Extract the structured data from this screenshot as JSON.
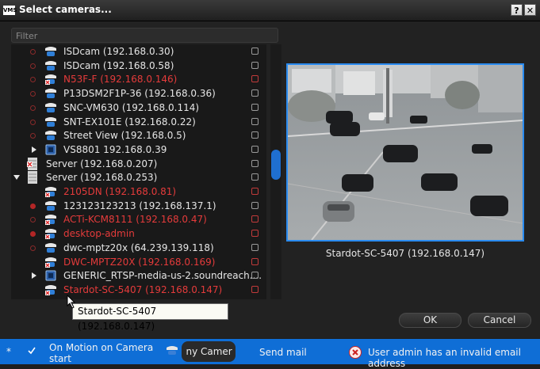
{
  "window": {
    "logo_text": "VMS",
    "title": "Select cameras...",
    "help_button": "?",
    "close_button": "✕"
  },
  "filter": {
    "placeholder": "Filter"
  },
  "tree": {
    "items": [
      {
        "label": "ISDcam (192.168.0.30)",
        "color": "white",
        "type": "camera",
        "status": "ring",
        "checkbox": "normal"
      },
      {
        "label": "ISDcam (192.168.0.58)",
        "color": "white",
        "type": "camera",
        "status": "ring",
        "checkbox": "normal"
      },
      {
        "label": "N53F-F (192.168.0.146)",
        "color": "red",
        "type": "camera",
        "status": "ring",
        "checkbox": "red"
      },
      {
        "label": "P13DSM2F1P-36 (192.168.0.36)",
        "color": "white",
        "type": "camera",
        "status": "ring",
        "checkbox": "normal"
      },
      {
        "label": "SNC-VM630 (192.168.0.114)",
        "color": "white",
        "type": "camera",
        "status": "ring",
        "checkbox": "normal"
      },
      {
        "label": "SNT-EX101E (192.168.0.22)",
        "color": "white",
        "type": "camera",
        "status": "ring",
        "checkbox": "normal"
      },
      {
        "label": "Street View (192.168.0.5)",
        "color": "white",
        "type": "camera",
        "status": "ring",
        "checkbox": "normal"
      },
      {
        "label": "VS8801 192.168.0.39",
        "color": "white",
        "type": "encoder",
        "status": "none",
        "checkbox": "normal"
      },
      {
        "label": "Server (192.168.0.207)",
        "color": "white",
        "type": "server-offline",
        "status": "none",
        "checkbox": "normal"
      },
      {
        "label": "Server (192.168.0.253)",
        "color": "white",
        "type": "server",
        "status": "none",
        "checkbox": "normal"
      },
      {
        "label": "2105DN (192.168.0.81)",
        "color": "red",
        "type": "camera",
        "status": "none",
        "checkbox": "red"
      },
      {
        "label": "123123123213 (192.168.137.1)",
        "color": "white",
        "type": "camera",
        "status": "solid",
        "checkbox": "normal"
      },
      {
        "label": "ACTi-KCM8111 (192.168.0.47)",
        "color": "red",
        "type": "camera",
        "status": "ring",
        "checkbox": "red"
      },
      {
        "label": "desktop-admin",
        "color": "red",
        "type": "camera",
        "status": "solid",
        "checkbox": "red"
      },
      {
        "label": "dwc-mptz20x (64.239.139.118)",
        "color": "white",
        "type": "camera",
        "status": "ring",
        "checkbox": "normal"
      },
      {
        "label": "DWC-MPTZ20X (192.168.0.169)",
        "color": "red",
        "type": "camera",
        "status": "none",
        "checkbox": "red"
      },
      {
        "label": "GENERIC_RTSP-media-us-2.soundreach....",
        "color": "white",
        "type": "encoder",
        "status": "none",
        "checkbox": "normal"
      },
      {
        "label": "Stardot-SC-5407 (192.168.0.147)",
        "color": "red",
        "type": "camera",
        "status": "none",
        "checkbox": "red"
      }
    ]
  },
  "preview": {
    "caption": "Stardot-SC-5407 (192.168.0.147)"
  },
  "tooltip": {
    "text": "Stardot-SC-5407 (192.168.0.147)"
  },
  "buttons": {
    "ok": "OK",
    "cancel": "Cancel"
  },
  "strip": {
    "star": "*",
    "rule_label_line1": "On Motion on Camera",
    "rule_label_line2": "start",
    "any_camera": " ny Camer",
    "action": "Send mail",
    "error": "User admin has an invalid email address"
  },
  "colors": {
    "accent": "#2a8bf0",
    "error_red": "#e53b3b",
    "strip_blue": "#0f6ed6"
  }
}
